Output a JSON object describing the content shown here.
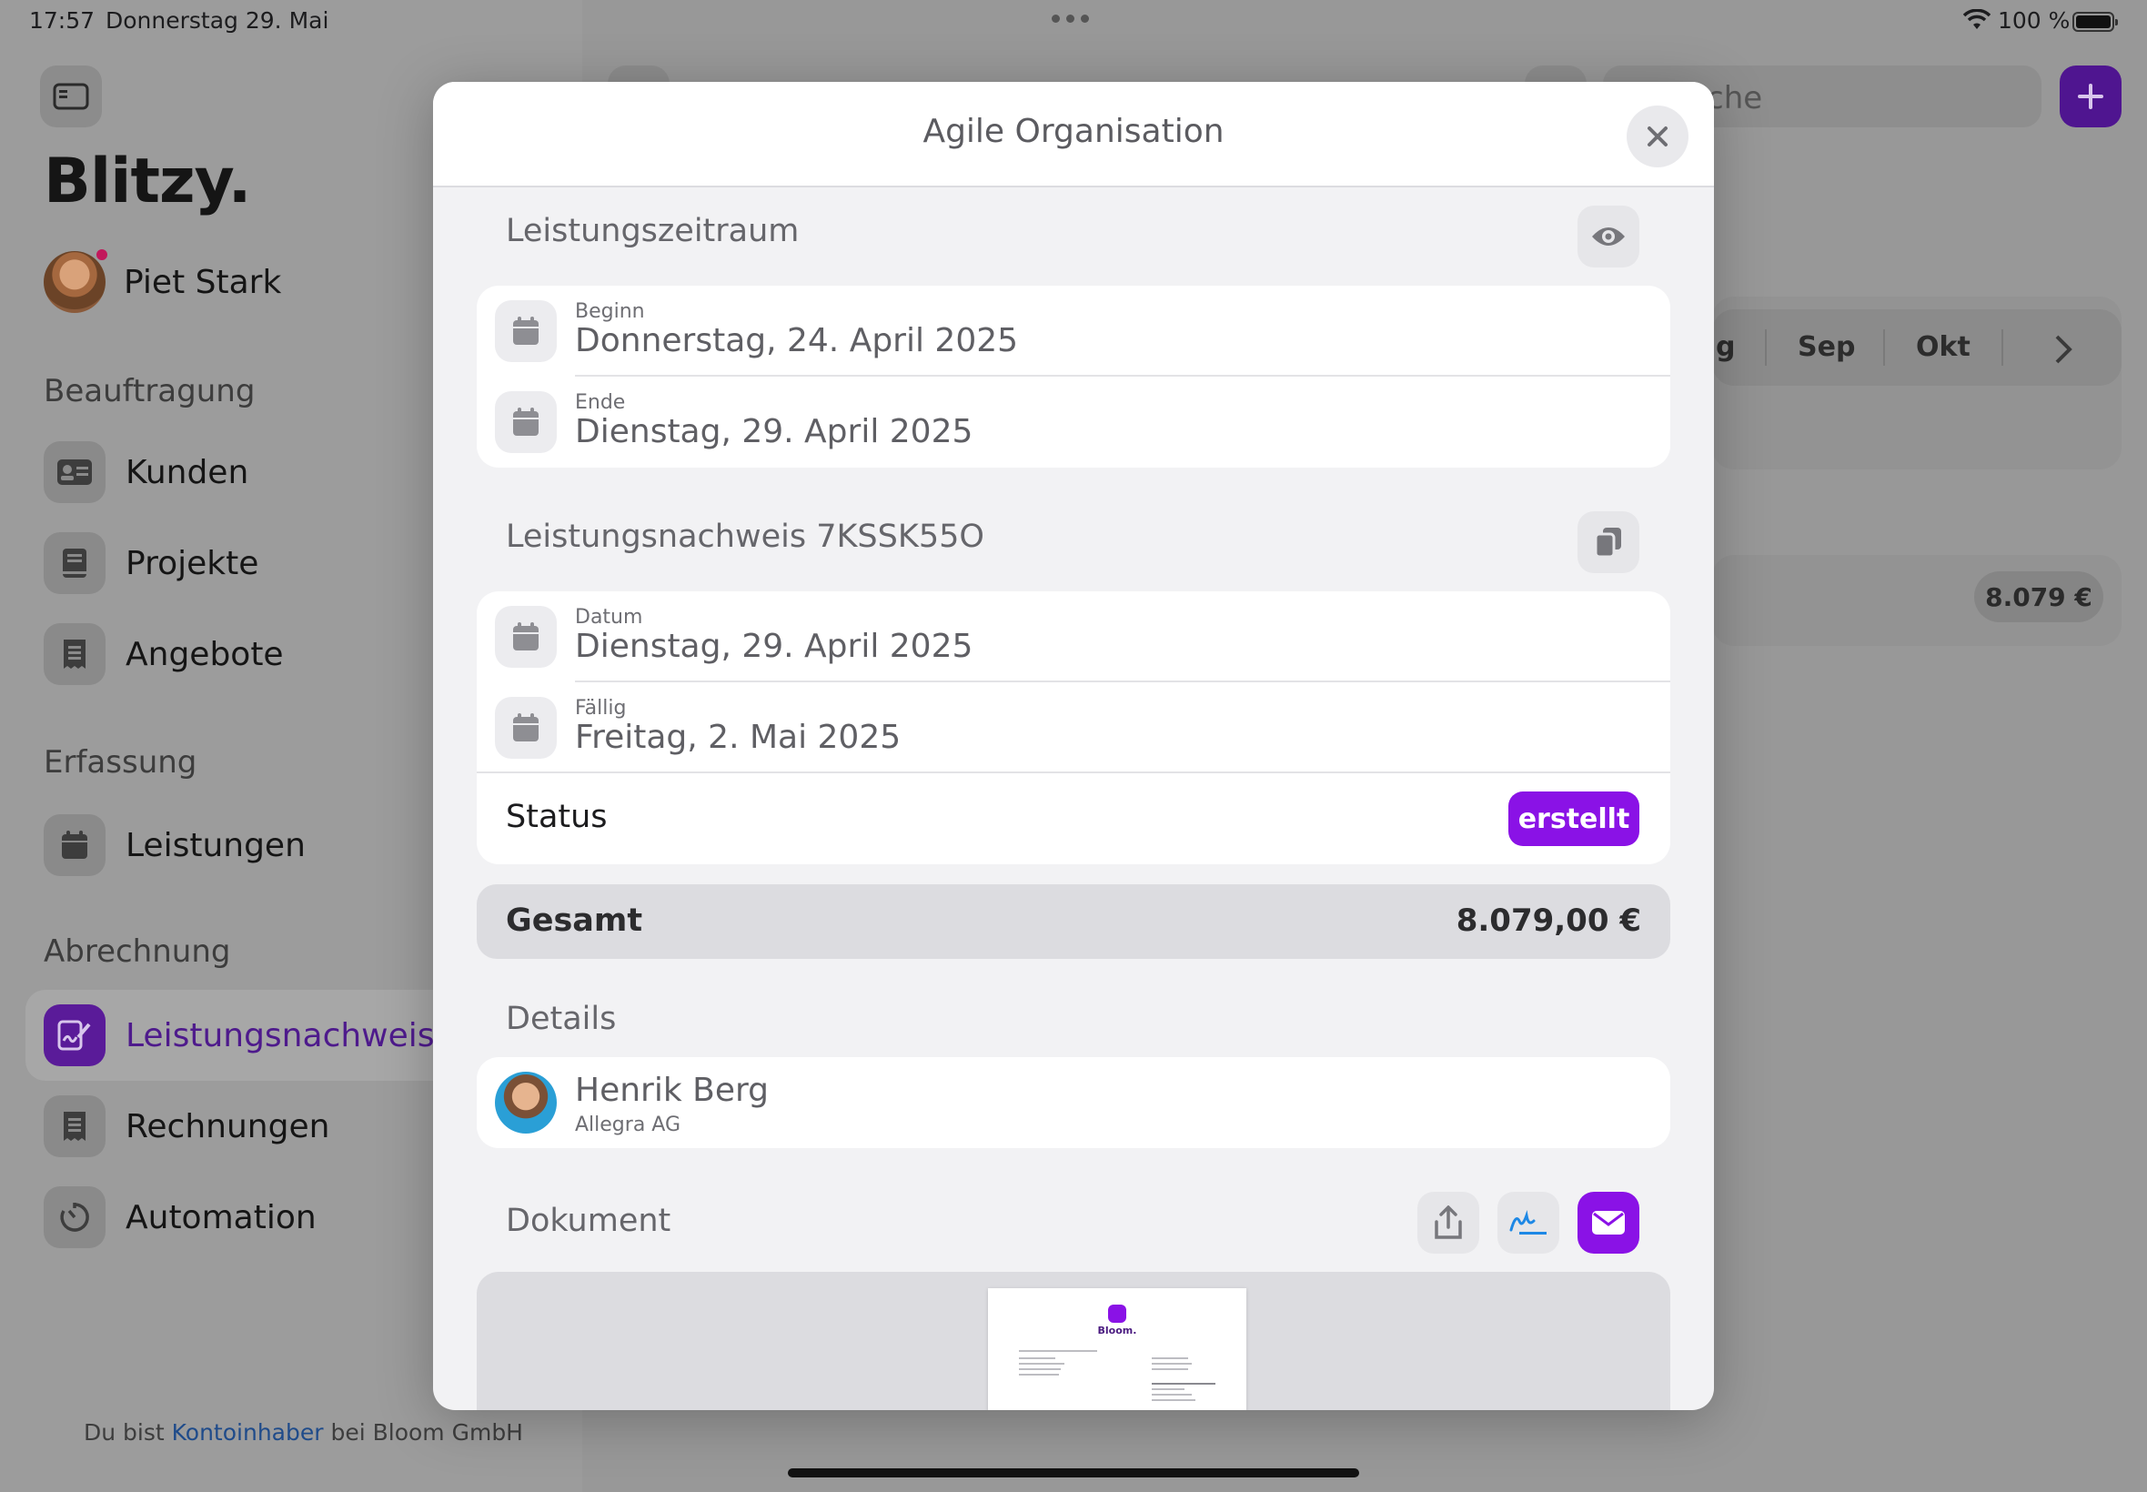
{
  "status_bar": {
    "time": "17:57",
    "date": "Donnerstag 29. Mai",
    "battery": "100 %"
  },
  "sidebar": {
    "brand": "Blitzy.",
    "user": {
      "name": "Piet Stark"
    },
    "sections": [
      {
        "label": "Beauftragung",
        "items": [
          {
            "label": "Kunden",
            "icon": "contact-card-icon"
          },
          {
            "label": "Projekte",
            "icon": "book-icon"
          },
          {
            "label": "Angebote",
            "icon": "receipt-icon"
          }
        ]
      },
      {
        "label": "Erfassung",
        "items": [
          {
            "label": "Leistungen",
            "icon": "calendar-icon"
          }
        ]
      },
      {
        "label": "Abrechnung",
        "items": [
          {
            "label": "Leistungsnachweise",
            "icon": "signed-document-icon",
            "active": true
          },
          {
            "label": "Rechnungen",
            "icon": "receipt-icon"
          },
          {
            "label": "Automation",
            "icon": "timer-icon"
          }
        ]
      }
    ],
    "footer": {
      "prefix": "Du bist ",
      "role": "Kontoinhaber",
      "suffix": " bei Bloom GmbH"
    }
  },
  "background": {
    "search_text": "che",
    "months": [
      "g",
      "Sep",
      "Okt"
    ],
    "amount": "8.079 €"
  },
  "modal": {
    "title": "Agile Organisation",
    "period": {
      "title": "Leistungszeitraum",
      "start_label": "Beginn",
      "start_value": "Donnerstag, 24. April 2025",
      "end_label": "Ende",
      "end_value": "Dienstag, 29. April 2025"
    },
    "proof": {
      "title": "Leistungsnachweis 7KSSK55O",
      "date_label": "Datum",
      "date_value": "Dienstag, 29. April 2025",
      "due_label": "Fällig",
      "due_value": "Freitag, 2. Mai 2025",
      "status_label": "Status",
      "status_value": "erstellt"
    },
    "total": {
      "label": "Gesamt",
      "value": "8.079,00 €"
    },
    "details": {
      "title": "Details",
      "contact_name": "Henrik Berg",
      "contact_company": "Allegra AG"
    },
    "document": {
      "title": "Dokument",
      "thumb_logo_text": "Bloom."
    }
  },
  "colors": {
    "accent": "#8a12e6",
    "accent_dimmed": "#5a1b99"
  }
}
